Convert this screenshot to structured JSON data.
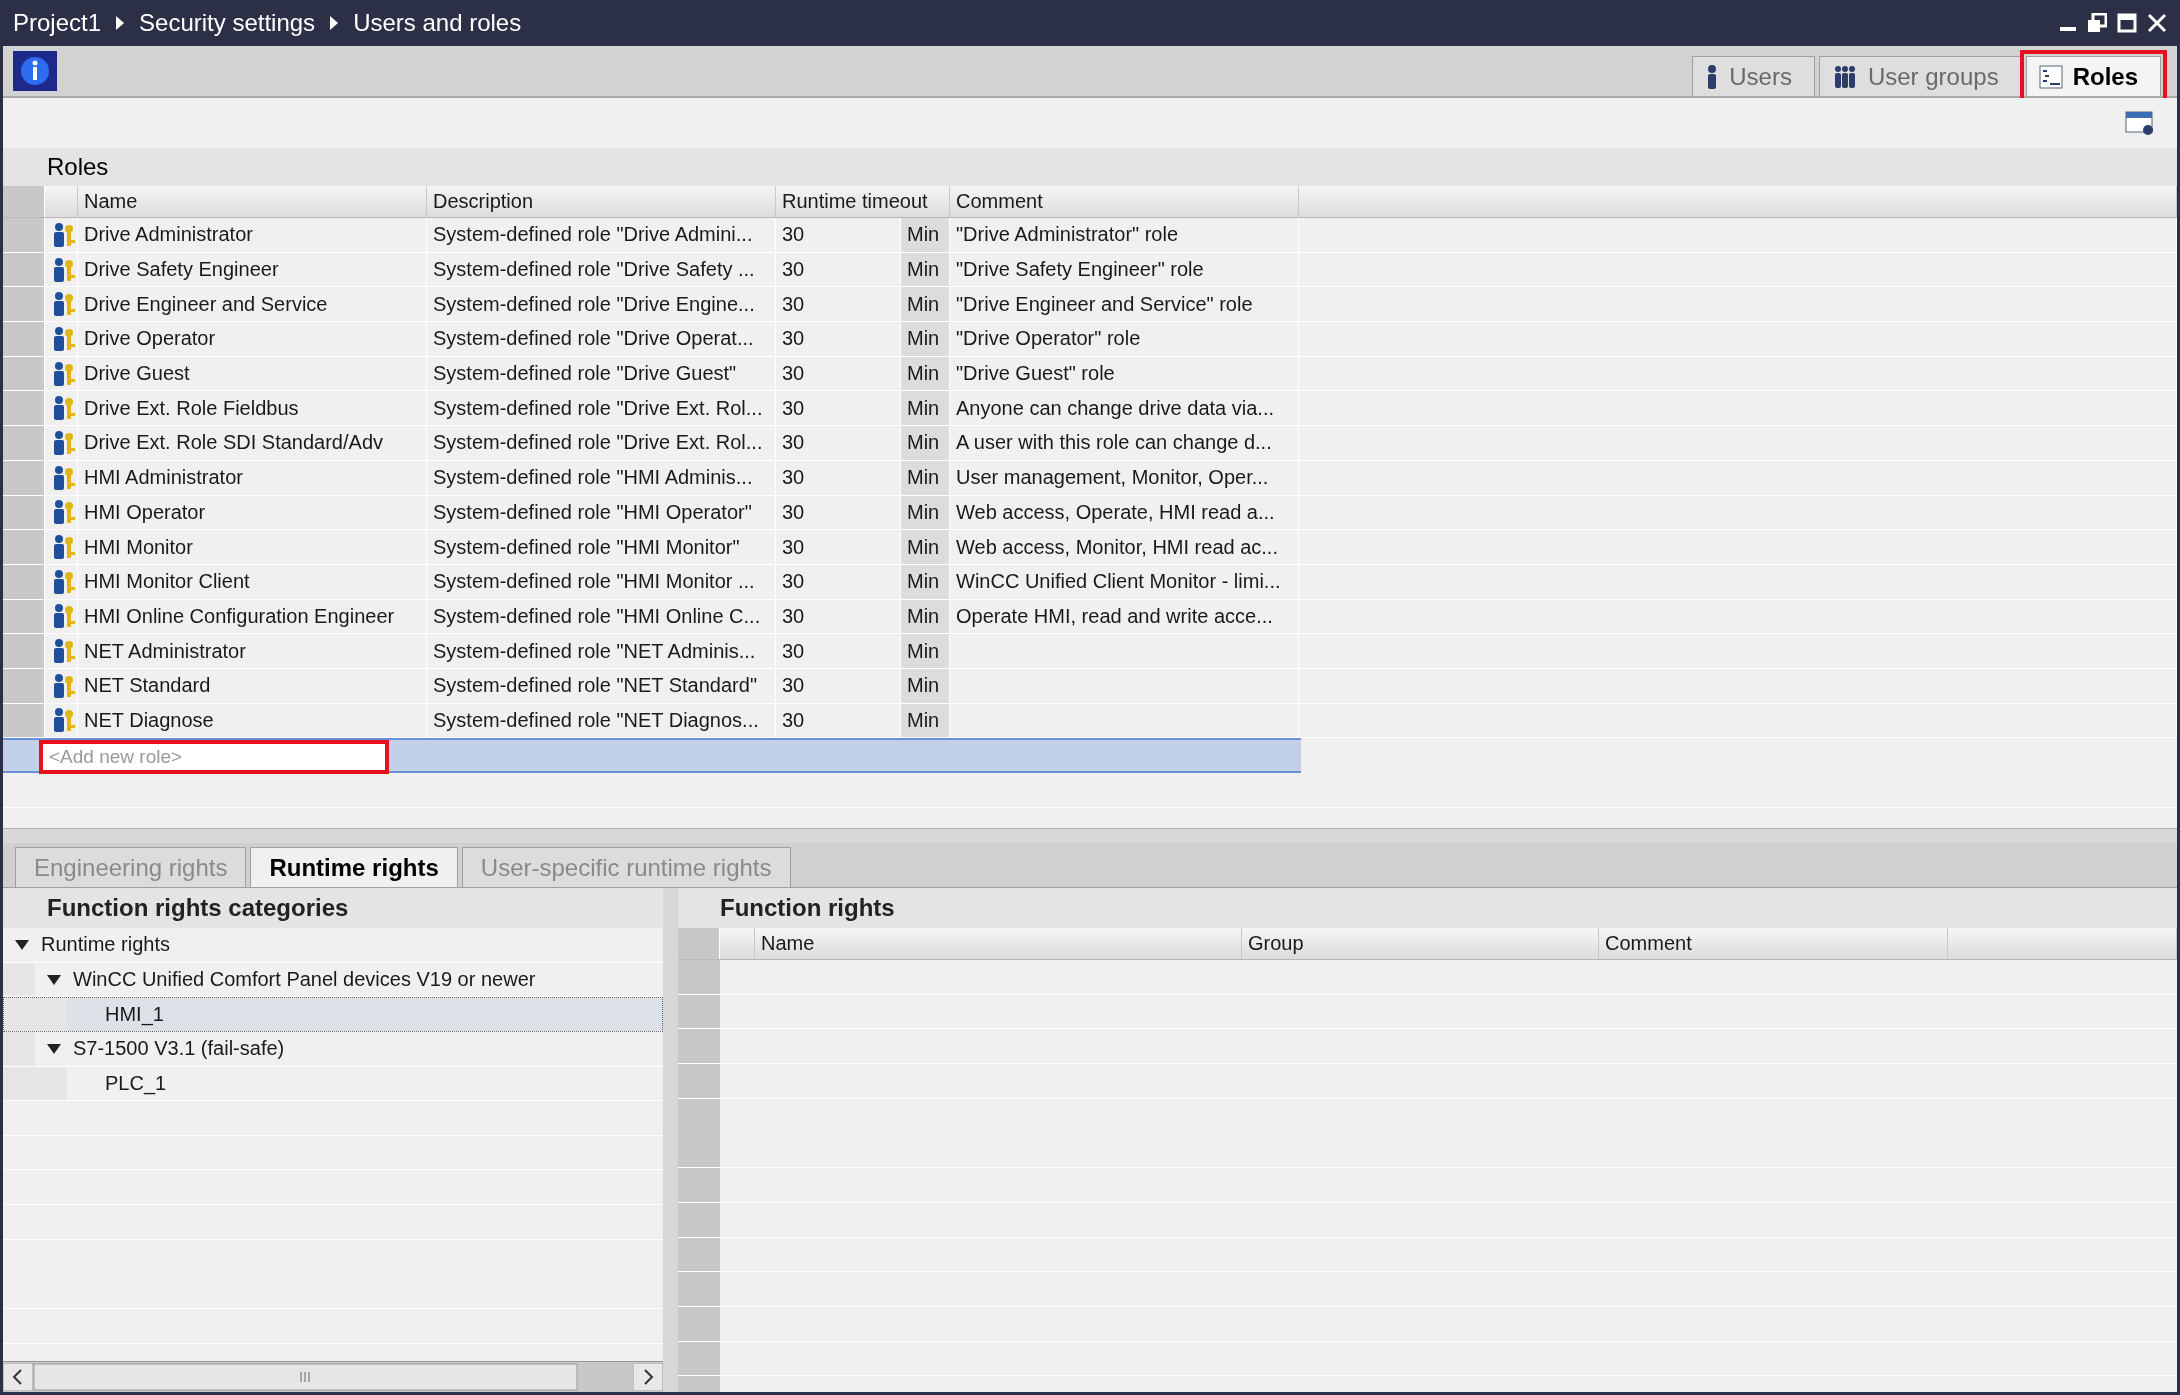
{
  "breadcrumb": [
    "Project1",
    "Security settings",
    "Users and roles"
  ],
  "view_tabs": [
    {
      "label": "Users",
      "kind": "user",
      "selected": false
    },
    {
      "label": "User groups",
      "kind": "group",
      "selected": false
    },
    {
      "label": "Roles",
      "kind": "role",
      "selected": true
    }
  ],
  "section_title": "Roles",
  "roles_table": {
    "columns": [
      "Name",
      "Description",
      "Runtime timeout",
      "Comment"
    ],
    "rows": [
      {
        "name": "Drive Administrator",
        "description": "System-defined role \"Drive Admini...",
        "timeout": "30",
        "unit": "Min",
        "comment": "\"Drive Administrator\" role"
      },
      {
        "name": "Drive Safety Engineer",
        "description": "System-defined role \"Drive Safety ...",
        "timeout": "30",
        "unit": "Min",
        "comment": "\"Drive Safety Engineer\" role"
      },
      {
        "name": "Drive Engineer and Service",
        "description": "System-defined role \"Drive Engine...",
        "timeout": "30",
        "unit": "Min",
        "comment": "\"Drive Engineer and Service\" role"
      },
      {
        "name": "Drive Operator",
        "description": "System-defined role \"Drive Operat...",
        "timeout": "30",
        "unit": "Min",
        "comment": "\"Drive Operator\" role"
      },
      {
        "name": "Drive Guest",
        "description": "System-defined role \"Drive Guest\"",
        "timeout": "30",
        "unit": "Min",
        "comment": "\"Drive Guest\" role"
      },
      {
        "name": "Drive Ext. Role Fieldbus",
        "description": "System-defined role \"Drive Ext. Rol...",
        "timeout": "30",
        "unit": "Min",
        "comment": "Anyone can change drive data via..."
      },
      {
        "name": "Drive Ext. Role SDI Standard/Adv",
        "description": "System-defined role \"Drive Ext. Rol...",
        "timeout": "30",
        "unit": "Min",
        "comment": "A user with this role can change d..."
      },
      {
        "name": "HMI Administrator",
        "description": "System-defined role \"HMI Adminis...",
        "timeout": "30",
        "unit": "Min",
        "comment": "User management, Monitor, Oper..."
      },
      {
        "name": "HMI Operator",
        "description": "System-defined role \"HMI Operator\"",
        "timeout": "30",
        "unit": "Min",
        "comment": "Web access, Operate, HMI read a..."
      },
      {
        "name": "HMI Monitor",
        "description": "System-defined role \"HMI Monitor\"",
        "timeout": "30",
        "unit": "Min",
        "comment": "Web access, Monitor, HMI read ac..."
      },
      {
        "name": "HMI Monitor Client",
        "description": "System-defined role \"HMI Monitor ...",
        "timeout": "30",
        "unit": "Min",
        "comment": "WinCC Unified Client Monitor - limi..."
      },
      {
        "name": "HMI Online Configuration Engineer",
        "description": "System-defined role \"HMI Online C...",
        "timeout": "30",
        "unit": "Min",
        "comment": "Operate HMI, read and write acce..."
      },
      {
        "name": "NET Administrator",
        "description": "System-defined role \"NET Adminis...",
        "timeout": "30",
        "unit": "Min"
      },
      {
        "name": "NET Standard",
        "description": "System-defined role \"NET Standard\"",
        "timeout": "30",
        "unit": "Min"
      },
      {
        "name": "NET Diagnose",
        "description": "System-defined role \"NET Diagnos...",
        "timeout": "30",
        "unit": "Min"
      }
    ],
    "add_row": {
      "placeholder": "<Add new role>",
      "highlighted": true
    }
  },
  "rights_tabs": [
    {
      "label": "Engineering rights",
      "selected": false
    },
    {
      "label": "Runtime rights",
      "selected": true
    },
    {
      "label": "User-specific runtime rights",
      "selected": false
    }
  ],
  "categories": {
    "title": "Function rights categories",
    "tree": [
      {
        "label": "Runtime rights",
        "expanded": true,
        "selected": false,
        "children": [
          {
            "label": "WinCC Unified Comfort Panel devices V19 or newer",
            "expanded": true,
            "selected": false,
            "children": [
              {
                "label": "HMI_1",
                "selected": true
              }
            ]
          },
          {
            "label": "S7-1500 V3.1 (fail-safe)",
            "expanded": true,
            "selected": false,
            "children": [
              {
                "label": "PLC_1",
                "selected": false
              }
            ]
          }
        ]
      }
    ]
  },
  "function_rights": {
    "title": "Function rights",
    "columns": [
      "Name",
      "Group",
      "Comment"
    ]
  }
}
